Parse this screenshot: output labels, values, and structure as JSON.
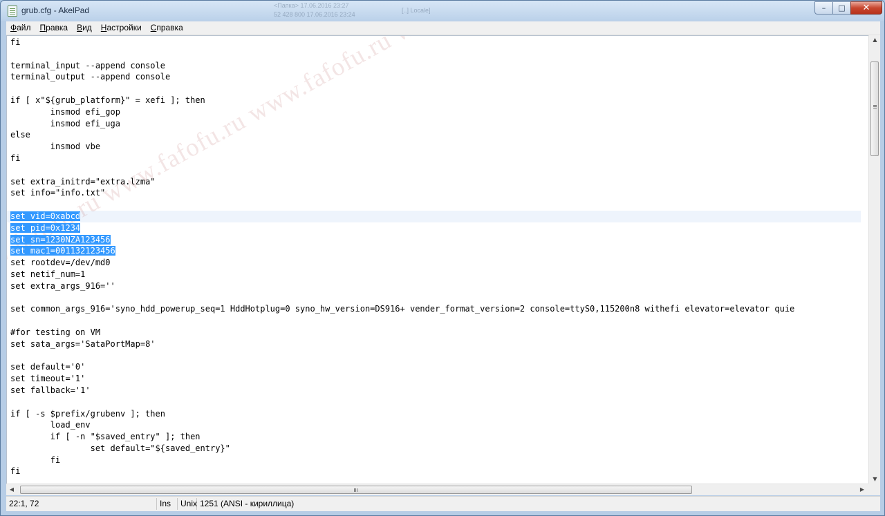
{
  "window": {
    "title": "grub.cfg - AkelPad",
    "background_glimpse_1": "<Папка> 17.06.2016 23:27",
    "background_glimpse_2": "52 428 800 17.06.2016 23:24",
    "background_glimpse_3": "[..] Locale]",
    "minimize_glyph": "–",
    "maximize_glyph": "□",
    "close_glyph": "✕"
  },
  "menu": [
    {
      "key": "Ф",
      "rest": "айл"
    },
    {
      "key": "П",
      "rest": "равка"
    },
    {
      "key": "В",
      "rest": "ид"
    },
    {
      "key": "Н",
      "rest": "астройки"
    },
    {
      "key": "С",
      "rest": "правка"
    }
  ],
  "editor": {
    "lines": [
      "fi",
      "",
      "terminal_input --append console",
      "terminal_output --append console",
      "",
      "if [ x\"${grub_platform}\" = xefi ]; then",
      "        insmod efi_gop",
      "        insmod efi_uga",
      "else",
      "        insmod vbe",
      "fi",
      "",
      "set extra_initrd=\"extra.lzma\"",
      "set info=\"info.txt\"",
      "",
      "set vid=0xabcd",
      "set pid=0x1234",
      "set sn=1230NZA123456",
      "set mac1=001132123456",
      "set rootdev=/dev/md0",
      "set netif_num=1",
      "set extra_args_916=''",
      "",
      "set common_args_916='syno_hdd_powerup_seq=1 HddHotplug=0 syno_hw_version=DS916+ vender_format_version=2 console=ttyS0,115200n8 withefi elevator=elevator quie",
      "",
      "#for testing on VM",
      "set sata_args='SataPortMap=8'",
      "",
      "set default='0'",
      "set timeout='1'",
      "set fallback='1'",
      "",
      "if [ -s $prefix/grubenv ]; then",
      "        load_env",
      "        if [ -n \"$saved_entry\" ]; then",
      "                set default=\"${saved_entry}\"",
      "        fi",
      "fi"
    ],
    "selected_lines": [
      15,
      16,
      17,
      18
    ],
    "current_line": 15,
    "watermark": "www.fafofu.ru www.fafofu.ru www.fafofu.ru www.fafofu.ru www.fafofu.ru",
    "selection_color": "#3399ff"
  },
  "scrollbars": {
    "up_glyph": "▲",
    "down_glyph": "▼",
    "left_glyph": "◀",
    "right_glyph": "▶"
  },
  "status": {
    "position": "22:1, 72",
    "insert_mode": "Ins",
    "newline": "Unix",
    "codepage": "1251  (ANSI - кириллица)"
  }
}
